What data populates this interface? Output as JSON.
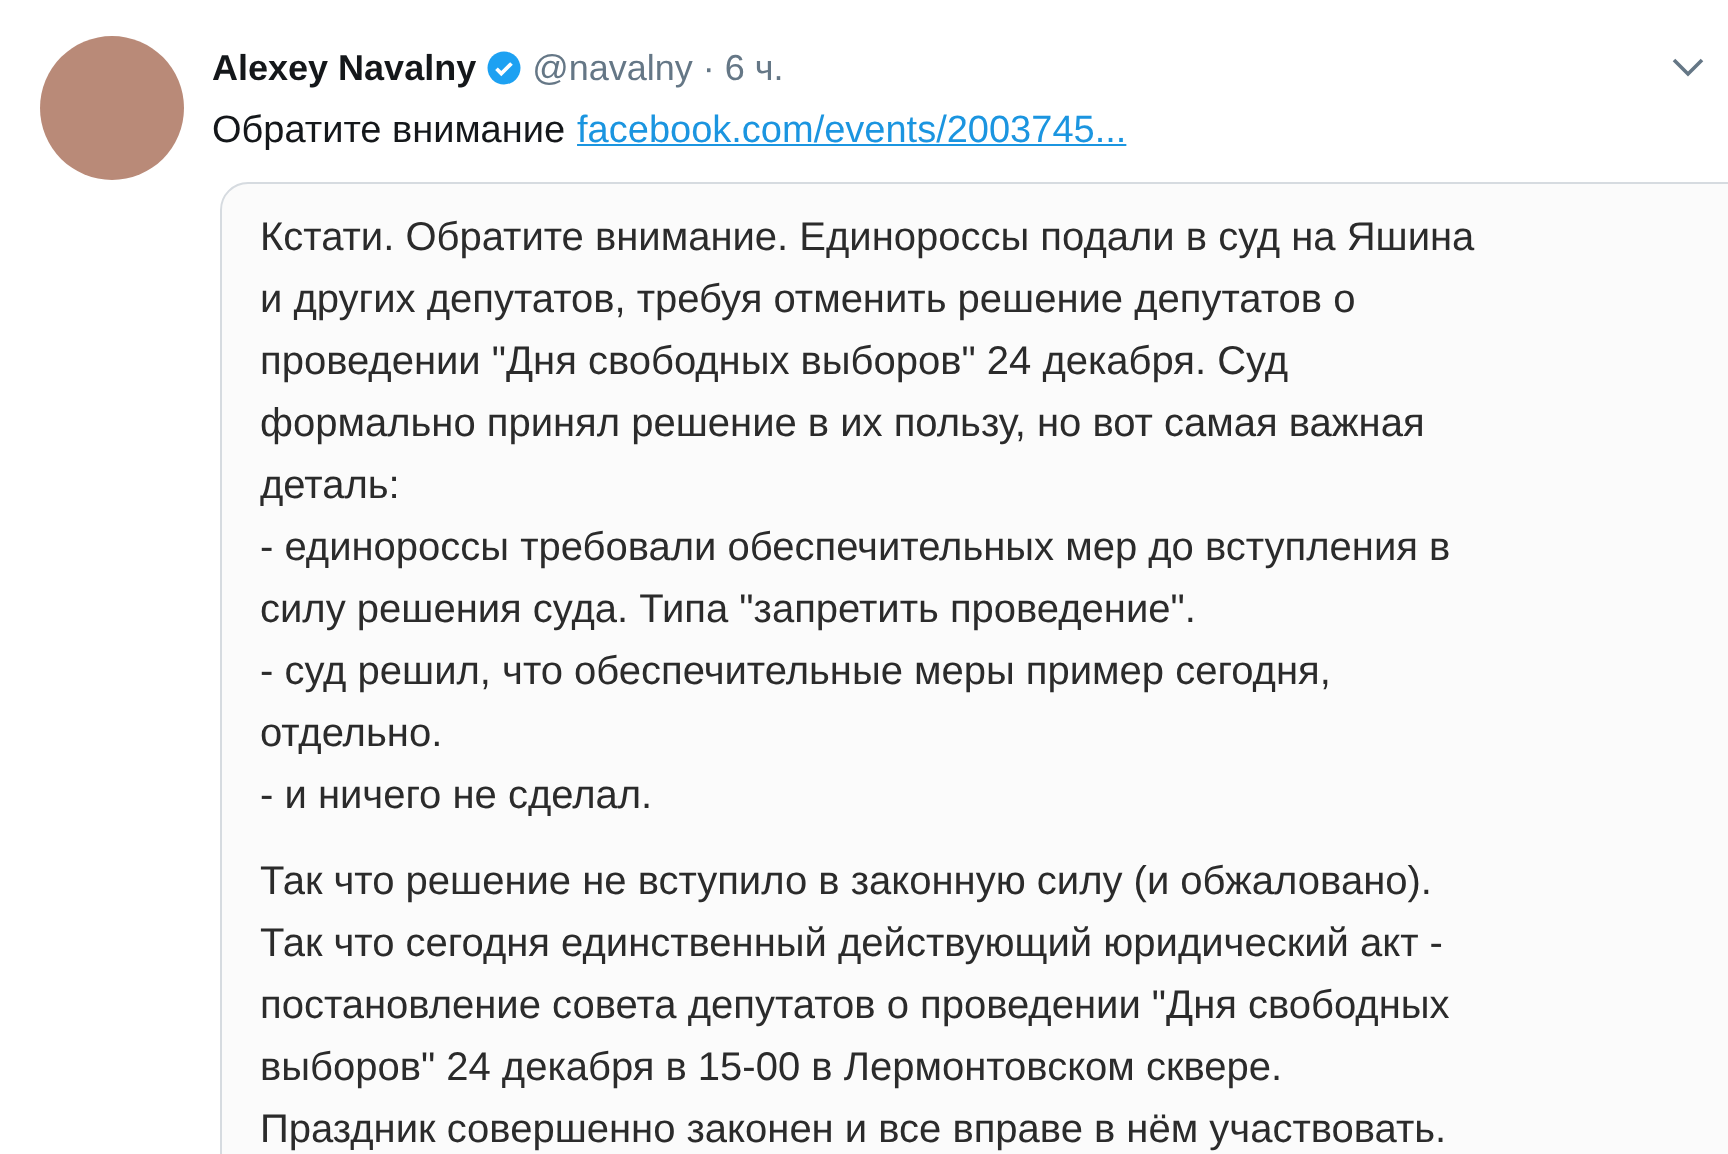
{
  "tweet": {
    "author": "Alexey Navalny",
    "handle": "@navalny",
    "separator": "·",
    "time": "6 ч.",
    "verified": true,
    "text": "Обратите внимание",
    "link": "facebook.com/events/2003745..."
  },
  "attached_post": {
    "paragraphs": [
      [
        "Кстати. Обратите внимание. Единороссы подали в суд на Яшина",
        "и других депутатов, требуя отменить решение депутатов о",
        "проведении \"Дня свободных выборов\" 24 декабря. Суд",
        "формально принял решение в их пользу, но вот самая важная",
        "деталь:",
        "- единороссы требовали обеспечительных мер до вступления в",
        "силу решения суда. Типа \"запретить проведение\".",
        "- суд решил, что обеспечительные меры пример сегодня,",
        "отдельно.",
        "- и ничего не сделал."
      ],
      [
        "Так что решение не вступило в законную силу (и обжаловано).",
        "Так что сегодня единственный действующий юридический акт -",
        "постановление совета депутатов о проведении \"Дня свободных",
        "выборов\" 24 декабря в 15-00 в Лермонтовском сквере.",
        "Праздник совершенно законен и все вправе в нём участвовать."
      ]
    ]
  }
}
